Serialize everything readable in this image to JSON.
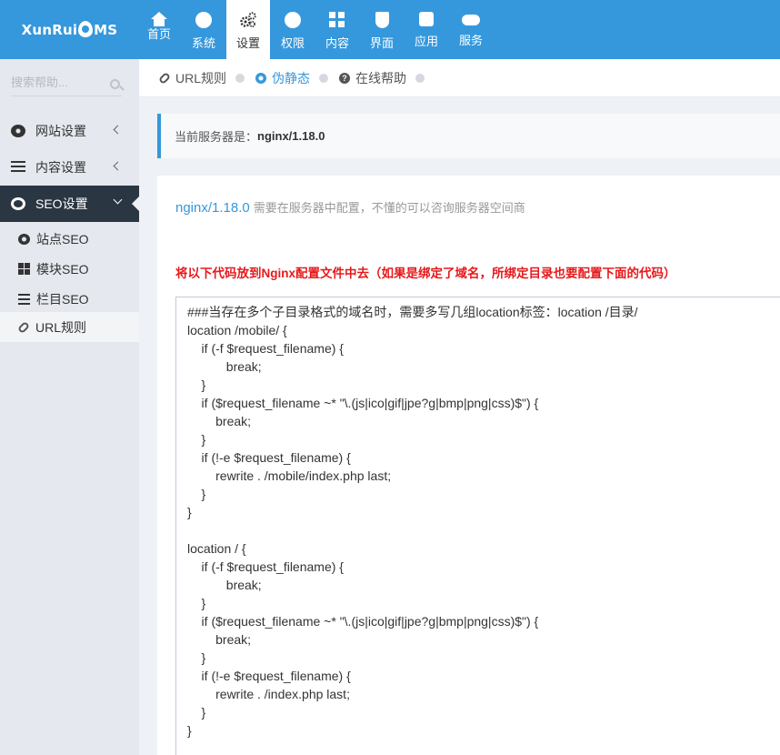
{
  "brand": {
    "logo_left": "XunRui",
    "logo_right": "MS"
  },
  "topnav": [
    {
      "label": "首页",
      "icon": "home-icon"
    },
    {
      "label": "系统",
      "icon": "globe-icon"
    },
    {
      "label": "设置",
      "icon": "gears-icon"
    },
    {
      "label": "权限",
      "icon": "user-icon"
    },
    {
      "label": "内容",
      "icon": "grid-icon"
    },
    {
      "label": "界面",
      "icon": "html5-icon"
    },
    {
      "label": "应用",
      "icon": "puzzle-icon"
    },
    {
      "label": "服务",
      "icon": "cloud-icon"
    }
  ],
  "sidebar": {
    "search_placeholder": "搜索帮助...",
    "menus": [
      {
        "label": "网站设置",
        "icon": "gear-icon"
      },
      {
        "label": "内容设置",
        "icon": "bars-icon"
      },
      {
        "label": "SEO设置",
        "icon": "ie-icon"
      }
    ],
    "submenu": [
      {
        "label": "站点SEO",
        "icon": "gear-icon"
      },
      {
        "label": "模块SEO",
        "icon": "grid-icon"
      },
      {
        "label": "栏目SEO",
        "icon": "list-icon"
      },
      {
        "label": "URL规则",
        "icon": "link-icon"
      }
    ]
  },
  "tabs": [
    {
      "label": "URL规则",
      "icon": "link-icon"
    },
    {
      "label": "伪静态",
      "icon": "gear-icon"
    },
    {
      "label": "在线帮助",
      "icon": "question-icon"
    }
  ],
  "note": {
    "prefix": "当前服务器是：",
    "server": "nginx/1.18.0"
  },
  "panel": {
    "server": "nginx/1.18.0",
    "desc": "需要在服务器中配置，不懂的可以咨询服务器空间商",
    "warning": "将以下代码放到Nginx配置文件中去（如果是绑定了域名，所绑定目录也要配置下面的代码）",
    "code": "###当存在多个子目录格式的域名时，需要多写几组location标签：location /目录/\nlocation /mobile/ {\n    if (-f $request_filename) {\n           break;\n    }\n    if ($request_filename ~* \"\\.(js|ico|gif|jpe?g|bmp|png|css)$\") {\n        break;\n    }\n    if (!-e $request_filename) {\n        rewrite . /mobile/index.php last;\n    }\n}\n\nlocation / {\n    if (-f $request_filename) {\n           break;\n    }\n    if ($request_filename ~* \"\\.(js|ico|gif|jpe?g|bmp|png|css)$\") {\n        break;\n    }\n    if (!-e $request_filename) {\n        rewrite . /index.php last;\n    }\n}"
  },
  "colors": {
    "primary": "#3598dc",
    "sidebar_bg": "#e5e8ee",
    "sidebar_active": "#2b3643",
    "warning": "#e7191b"
  }
}
